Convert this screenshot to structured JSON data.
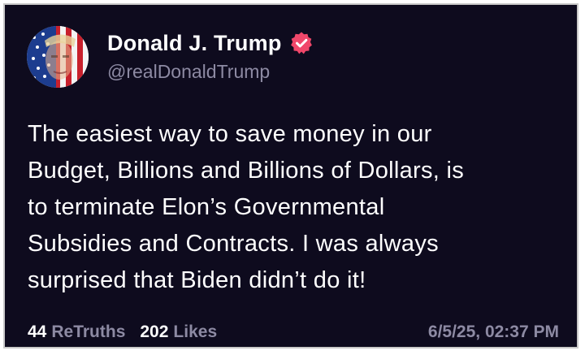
{
  "post": {
    "author": {
      "display_name": "Donald J. Trump",
      "handle": "@realDonaldTrump",
      "verified": true,
      "avatar_icon": "profile-photo-flag-icon"
    },
    "body_lines": [
      "The easiest way to save money in our",
      "Budget, Billions and Billions of Dollars, is",
      "to terminate Elon’s Governmental",
      "Subsidies and Contracts. I was always",
      "surprised that Biden didn’t do it!"
    ],
    "stats": {
      "retruths_count": "44",
      "retruths_label": "ReTruths",
      "likes_count": "202",
      "likes_label": "Likes"
    },
    "timestamp": "6/5/25, 02:37 PM"
  },
  "colors": {
    "background": "#0e0b1e",
    "text_primary": "#ffffff",
    "text_secondary": "#8d8aa3",
    "verified_badge": "#f0476a"
  }
}
